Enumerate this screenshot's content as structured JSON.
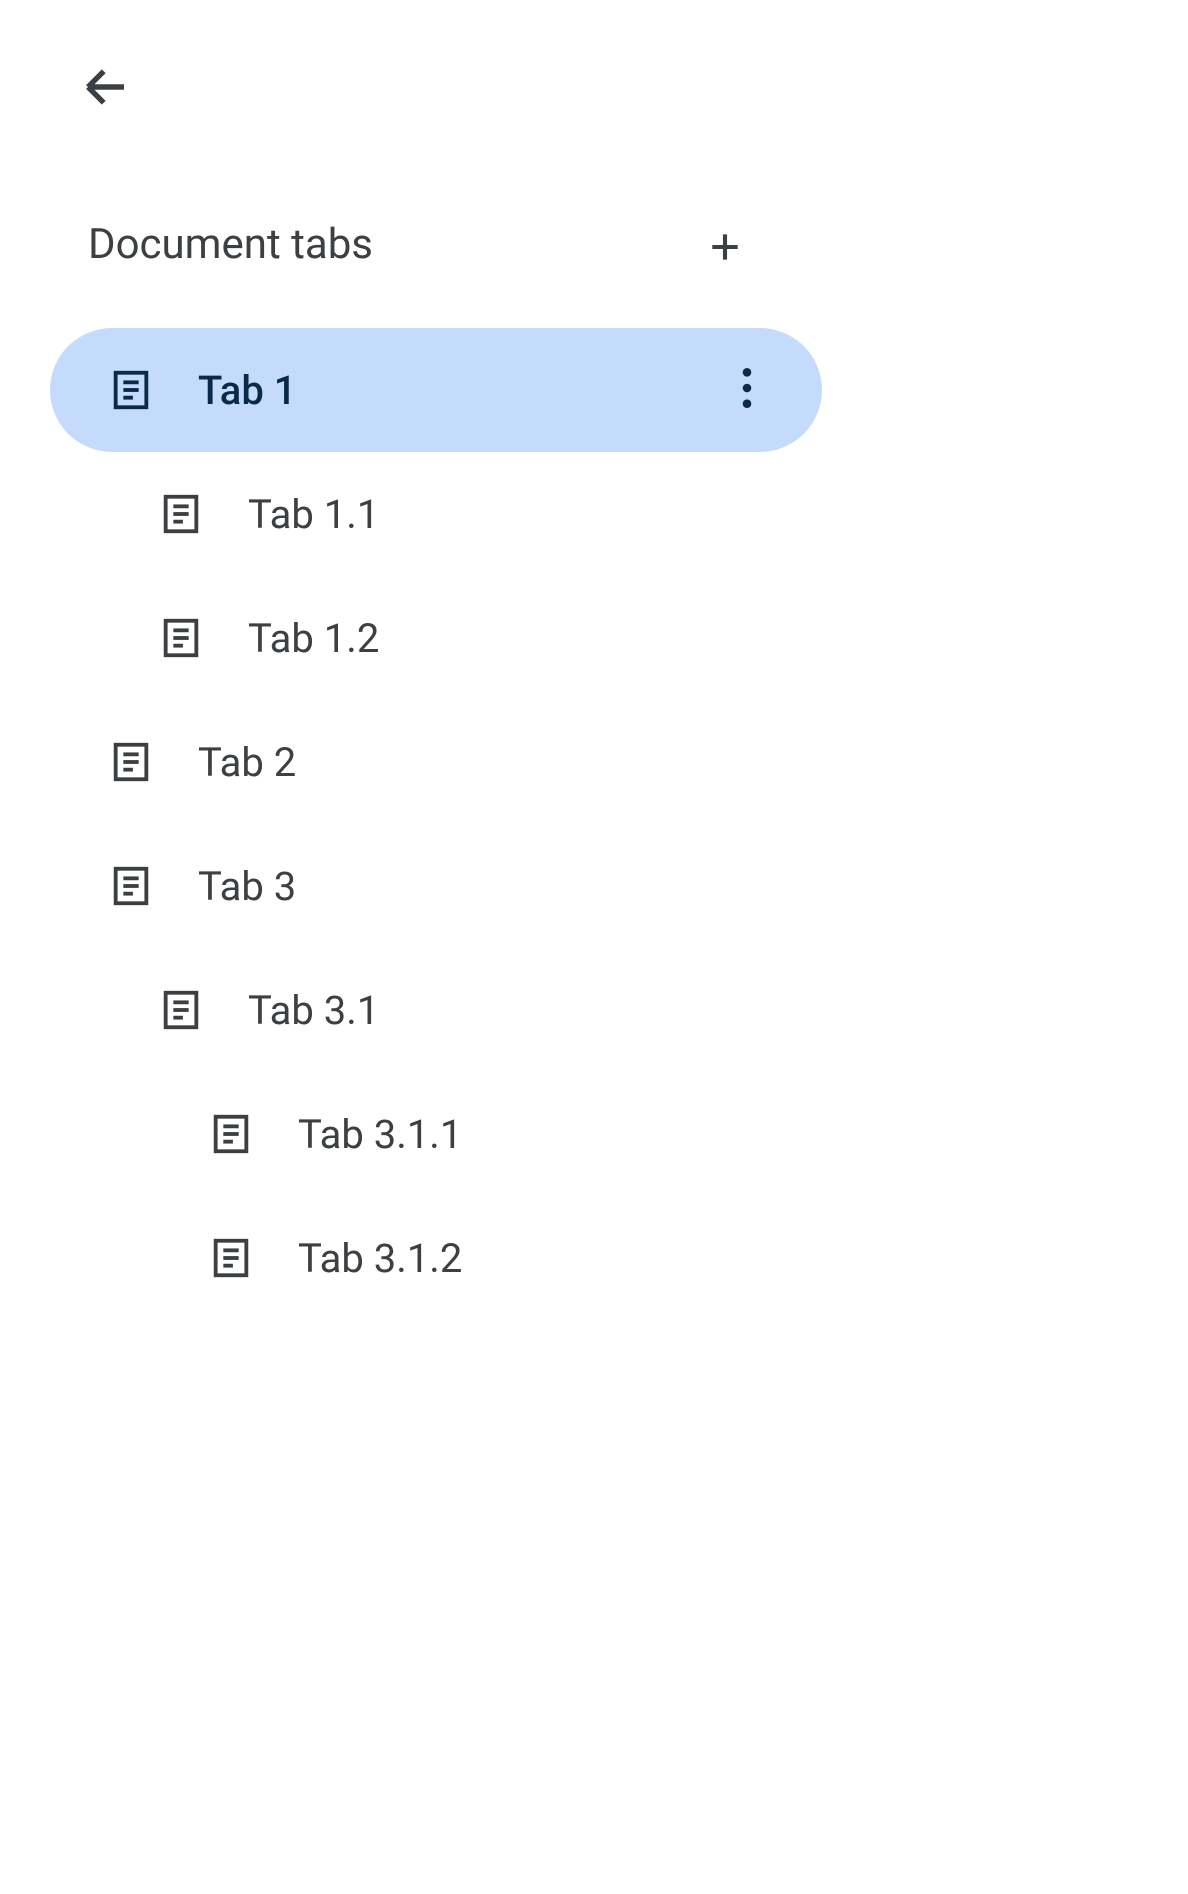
{
  "header": {
    "title": "Document tabs"
  },
  "tabs": [
    {
      "label": "Tab 1",
      "indent": 0,
      "selected": true
    },
    {
      "label": "Tab 1.1",
      "indent": 1,
      "selected": false
    },
    {
      "label": "Tab 1.2",
      "indent": 1,
      "selected": false
    },
    {
      "label": "Tab 2",
      "indent": 0,
      "selected": false
    },
    {
      "label": "Tab 3",
      "indent": 0,
      "selected": false
    },
    {
      "label": "Tab 3.1",
      "indent": 1,
      "selected": false
    },
    {
      "label": "Tab 3.1.1",
      "indent": 2,
      "selected": false
    },
    {
      "label": "Tab 3.1.2",
      "indent": 2,
      "selected": false
    }
  ]
}
